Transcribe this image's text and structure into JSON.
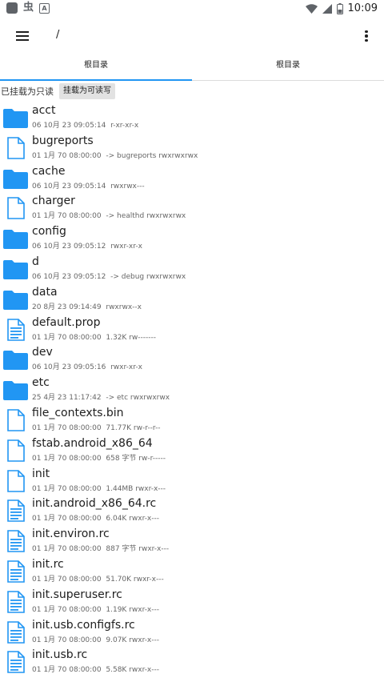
{
  "status_bar": {
    "icons": [
      "app-square-icon",
      "bug-icon",
      "a-icon",
      "wifi-icon",
      "signal-icon",
      "battery-icon"
    ],
    "bug_glyph": "虫",
    "a_glyph": "A",
    "time": "10:09"
  },
  "appbar": {
    "path": "/"
  },
  "tabs": [
    {
      "label": "根目录",
      "active": true
    },
    {
      "label": "根目录",
      "active": false
    }
  ],
  "mount": {
    "status_label": "已挂载为只读",
    "button_label": "挂载为可读写"
  },
  "colors": {
    "accent": "#2196f3",
    "folder": "#2196f3",
    "file_stroke": "#2196f3"
  },
  "files": [
    {
      "name": "acct",
      "date": "06 10月 23 09:05:14",
      "info": "r-xr-xr-x",
      "icon": "folder-icon"
    },
    {
      "name": "bugreports",
      "date": "01 1月 70 08:00:00",
      "info": "-> bugreports  rwxrwxrwx",
      "icon": "file-icon"
    },
    {
      "name": "cache",
      "date": "06 10月 23 09:05:14",
      "info": "rwxrwx---",
      "icon": "folder-icon"
    },
    {
      "name": "charger",
      "date": "01 1月 70 08:00:00",
      "info": "-> healthd  rwxrwxrwx",
      "icon": "file-icon"
    },
    {
      "name": "config",
      "date": "06 10月 23 09:05:12",
      "info": "rwxr-xr-x",
      "icon": "folder-icon"
    },
    {
      "name": "d",
      "date": "06 10月 23 09:05:12",
      "info": "-> debug  rwxrwxrwx",
      "icon": "folder-icon"
    },
    {
      "name": "data",
      "date": "20 8月 23 09:14:49",
      "info": "rwxrwx--x",
      "icon": "folder-icon"
    },
    {
      "name": "default.prop",
      "date": "01 1月 70 08:00:00",
      "info": "1.32K  rw-------",
      "icon": "text-file-icon"
    },
    {
      "name": "dev",
      "date": "06 10月 23 09:05:16",
      "info": "rwxr-xr-x",
      "icon": "folder-icon"
    },
    {
      "name": "etc",
      "date": "25 4月 23 11:17:42",
      "info": "-> etc  rwxrwxrwx",
      "icon": "folder-icon"
    },
    {
      "name": "file_contexts.bin",
      "date": "01 1月 70 08:00:00",
      "info": "71.77K  rw-r--r--",
      "icon": "file-icon"
    },
    {
      "name": "fstab.android_x86_64",
      "date": "01 1月 70 08:00:00",
      "info": "658 字节  rw-r-----",
      "icon": "file-icon"
    },
    {
      "name": "init",
      "date": "01 1月 70 08:00:00",
      "info": "1.44MB  rwxr-x---",
      "icon": "file-icon"
    },
    {
      "name": "init.android_x86_64.rc",
      "date": "01 1月 70 08:00:00",
      "info": "6.04K  rwxr-x---",
      "icon": "text-file-icon"
    },
    {
      "name": "init.environ.rc",
      "date": "01 1月 70 08:00:00",
      "info": "887 字节  rwxr-x---",
      "icon": "text-file-icon"
    },
    {
      "name": "init.rc",
      "date": "01 1月 70 08:00:00",
      "info": "51.70K  rwxr-x---",
      "icon": "text-file-icon"
    },
    {
      "name": "init.superuser.rc",
      "date": "01 1月 70 08:00:00",
      "info": "1.19K  rwxr-x---",
      "icon": "text-file-icon"
    },
    {
      "name": "init.usb.configfs.rc",
      "date": "01 1月 70 08:00:00",
      "info": "9.07K  rwxr-x---",
      "icon": "text-file-icon"
    },
    {
      "name": "init.usb.rc",
      "date": "01 1月 70 08:00:00",
      "info": "5.58K  rwxr-x---",
      "icon": "text-file-icon"
    }
  ]
}
